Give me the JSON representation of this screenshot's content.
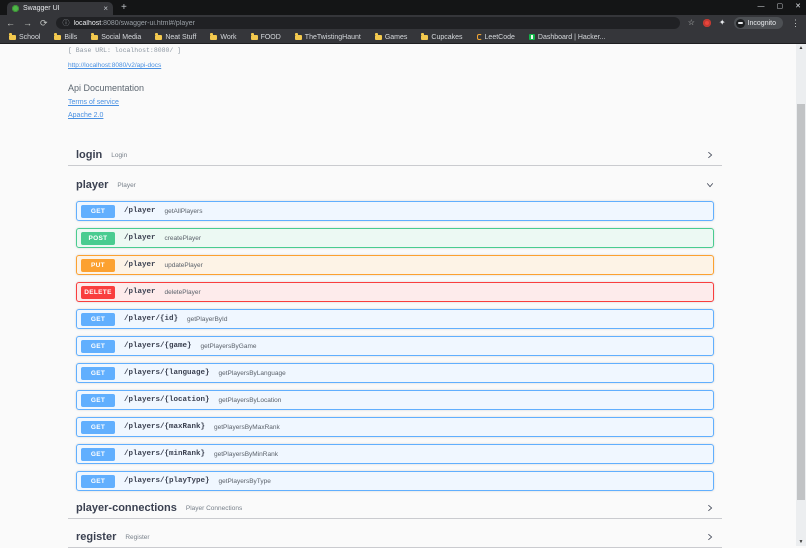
{
  "browser": {
    "tab_title": "Swagger UI",
    "url_host": "localhost",
    "url_rest": ":8080/swagger-ui.html#/player",
    "incognito_label": "Incognito",
    "icons": {
      "back": "←",
      "forward": "→",
      "reload": "⟳",
      "info": "ⓘ",
      "bookmark_star": "☆",
      "extensions_star": "✦",
      "menu": "⋮",
      "tab_close": "×",
      "new_tab": "+",
      "minimize": "—",
      "maximize": "▢",
      "close": "✕",
      "scroll_up": "▲",
      "scroll_down": "▼"
    },
    "bookmarks": [
      {
        "label": "School"
      },
      {
        "label": "Bills"
      },
      {
        "label": "Social Media"
      },
      {
        "label": "Neat Stuff"
      },
      {
        "label": "Work"
      },
      {
        "label": "FOOD"
      },
      {
        "label": "TheTwistingHaunt"
      },
      {
        "label": "Games"
      },
      {
        "label": "Cupcakes"
      },
      {
        "label": "LeetCode"
      },
      {
        "label": "Dashboard | Hacker..."
      }
    ]
  },
  "api": {
    "base_url": "[ Base URL: localhost:8080/ ]",
    "docs_link": "http://localhost:8080/v2/api-docs",
    "title": "Api Documentation",
    "terms_link": "Terms of service",
    "license_link": "Apache 2.0"
  },
  "sections": {
    "login": {
      "name": "login",
      "description": "Login"
    },
    "player": {
      "name": "player",
      "description": "Player"
    },
    "player_connections": {
      "name": "player-connections",
      "description": "Player Connections"
    },
    "register": {
      "name": "register",
      "description": "Register"
    }
  },
  "operations": [
    {
      "method": "GET",
      "path": "/player",
      "summary": "getAllPlayers"
    },
    {
      "method": "POST",
      "path": "/player",
      "summary": "createPlayer"
    },
    {
      "method": "PUT",
      "path": "/player",
      "summary": "updatePlayer"
    },
    {
      "method": "DELETE",
      "path": "/player",
      "summary": "deletePlayer"
    },
    {
      "method": "GET",
      "path": "/player/{id}",
      "summary": "getPlayerById"
    },
    {
      "method": "GET",
      "path": "/players/{game}",
      "summary": "getPlayersByGame"
    },
    {
      "method": "GET",
      "path": "/players/{language}",
      "summary": "getPlayersByLanguage"
    },
    {
      "method": "GET",
      "path": "/players/{location}",
      "summary": "getPlayersByLocation"
    },
    {
      "method": "GET",
      "path": "/players/{maxRank}",
      "summary": "getPlayersByMaxRank"
    },
    {
      "method": "GET",
      "path": "/players/{minRank}",
      "summary": "getPlayersByMinRank"
    },
    {
      "method": "GET",
      "path": "/players/{playType}",
      "summary": "getPlayersByType"
    }
  ],
  "colors": {
    "get": "#61affe",
    "post": "#49cc90",
    "put": "#fca130",
    "delete": "#f93e3e",
    "link": "#4990e2",
    "text": "#3b4151"
  }
}
